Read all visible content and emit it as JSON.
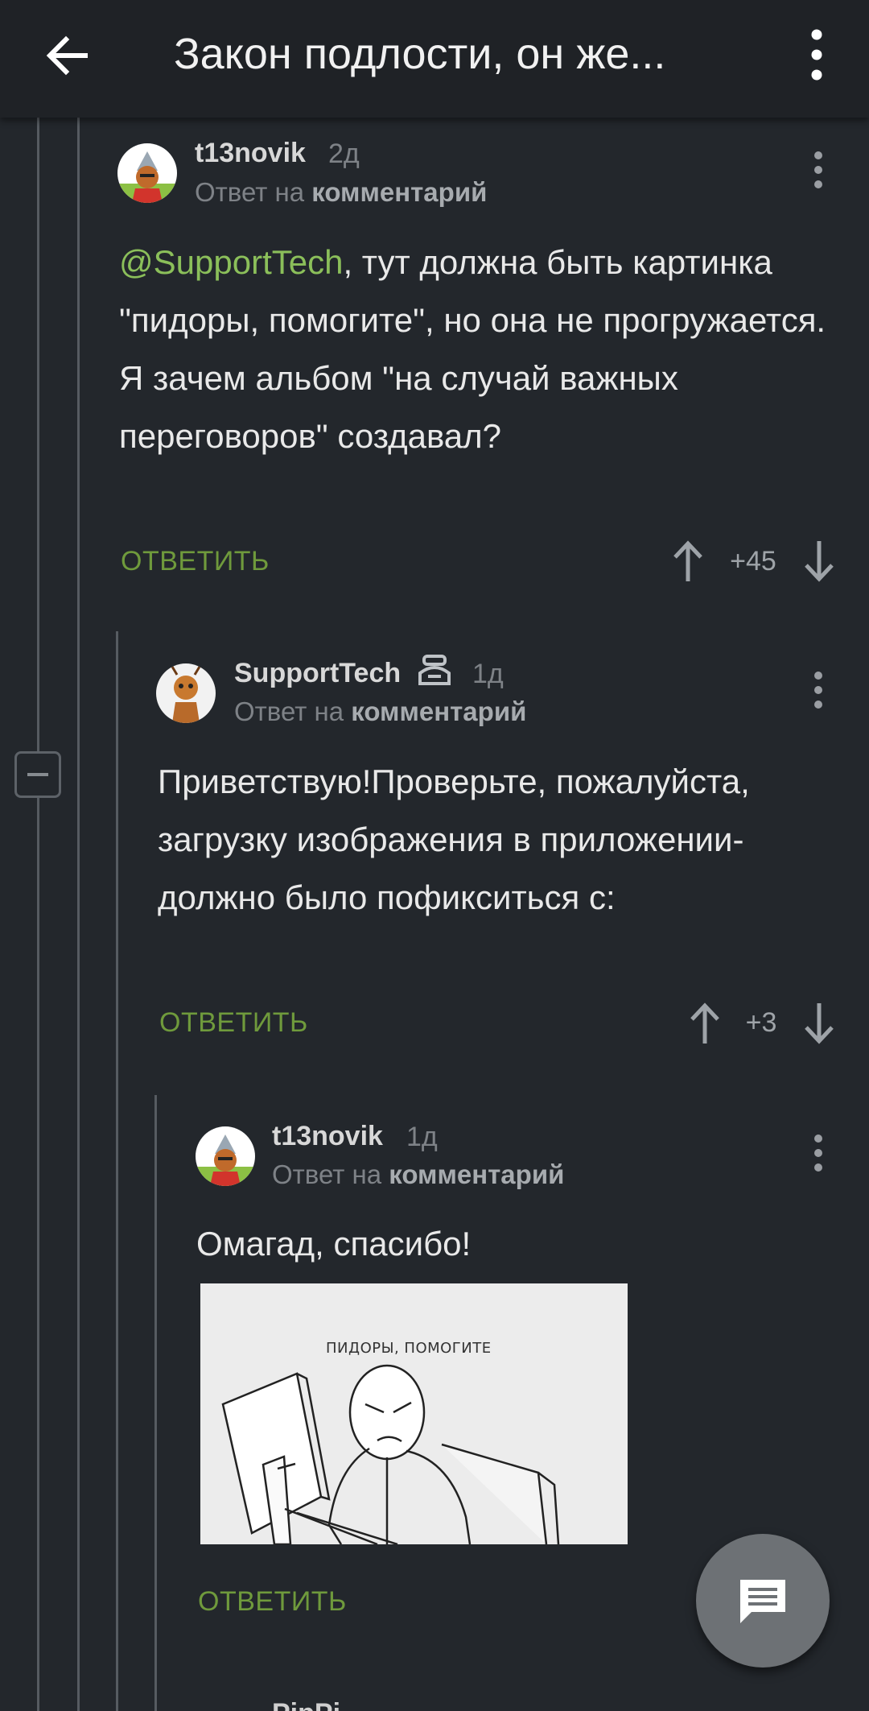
{
  "header": {
    "title": "Закон подлости, он же...",
    "back_icon": "arrow-left-icon",
    "menu_icon": "more-vertical-icon"
  },
  "comments": [
    {
      "author": "t13novik",
      "time": "2д",
      "reply_prefix": "Ответ на",
      "reply_target": "комментарий",
      "mention": "@SupportTech",
      "text": ", тут должна быть картинка \"пидоры, помогите\", но она не прогружается. Я зачем альбом \"на случай важных переговоров\" создавал?",
      "reply_label": "ОТВЕТИТЬ",
      "rating": "+45"
    },
    {
      "author": "SupportTech",
      "badge_icon": "support-badge-icon",
      "time": "1д",
      "reply_prefix": "Ответ на",
      "reply_target": "комментарий",
      "text": "Приветствую!Проверьте, пожалуйста, загрузку изображения в приложении- должно было пофикситься с:",
      "reply_label": "ОТВЕТИТЬ",
      "rating": "+3"
    },
    {
      "author": "t13novik",
      "time": "1д",
      "reply_prefix": "Ответ на",
      "reply_target": "комментарий",
      "text": "Омагад, спасибо!",
      "image_caption": "ПИДОРЫ, ПОМОГИТЕ",
      "reply_label": "ОТВЕТИТЬ"
    }
  ],
  "next_comment_author_partial": "PipPi",
  "fab_icon": "comment-icon",
  "colors": {
    "background": "#23272c",
    "topbar": "#1f2226",
    "accent_green": "#6f9a3c",
    "mention_green": "#8bbf5a",
    "fab": "#6d7175"
  }
}
